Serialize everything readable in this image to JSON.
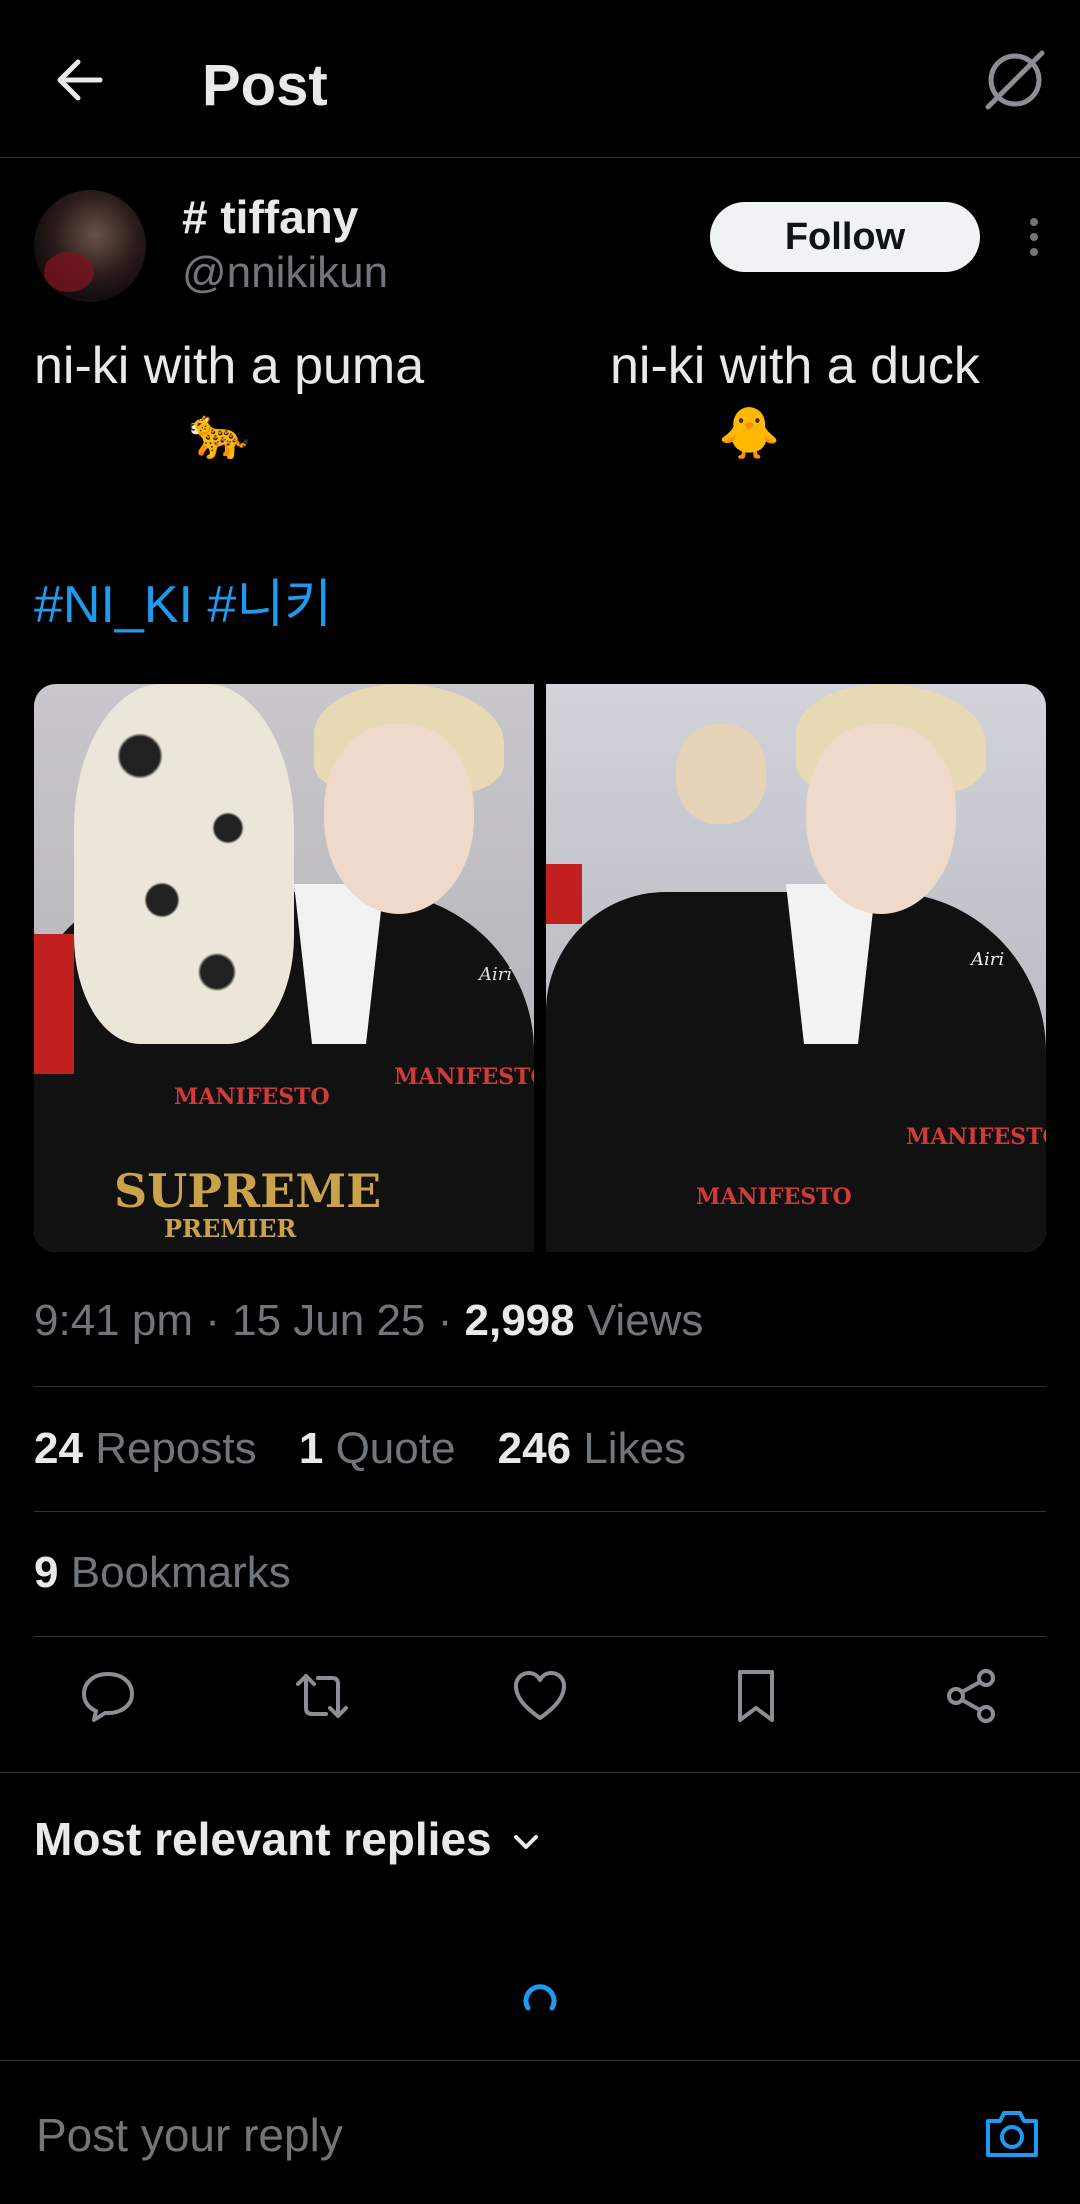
{
  "header": {
    "title": "Post"
  },
  "author": {
    "display_name": "# tiffany",
    "handle": "@nnikikun",
    "follow_label": "Follow"
  },
  "post": {
    "left_caption": "ni-ki with a puma",
    "left_emoji": "🐆",
    "right_caption": "ni-ki with a duck",
    "right_emoji": "🐥",
    "hashtags": "#NI_KI #니키",
    "media": {
      "watermark_left": "Airi",
      "watermark_right": "Airi",
      "print_left_1": "MANIFESTO",
      "print_left_2": "SUPREME",
      "print_left_3": "PREMIER",
      "print_right_1": "MANIFESTO"
    },
    "time": "9:41 pm",
    "date": "15 Jun 25",
    "views_count": "2,998",
    "views_label": "Views"
  },
  "stats": {
    "reposts_count": "24",
    "reposts_label": "Reposts",
    "quotes_count": "1",
    "quotes_label": "Quote",
    "likes_count": "246",
    "likes_label": "Likes",
    "bookmarks_count": "9",
    "bookmarks_label": "Bookmarks"
  },
  "replies": {
    "sort_label": "Most relevant replies"
  },
  "composer": {
    "placeholder": "Post your reply"
  },
  "colors": {
    "accent": "#1d9bf0",
    "background": "#000000",
    "muted": "#71767b"
  }
}
